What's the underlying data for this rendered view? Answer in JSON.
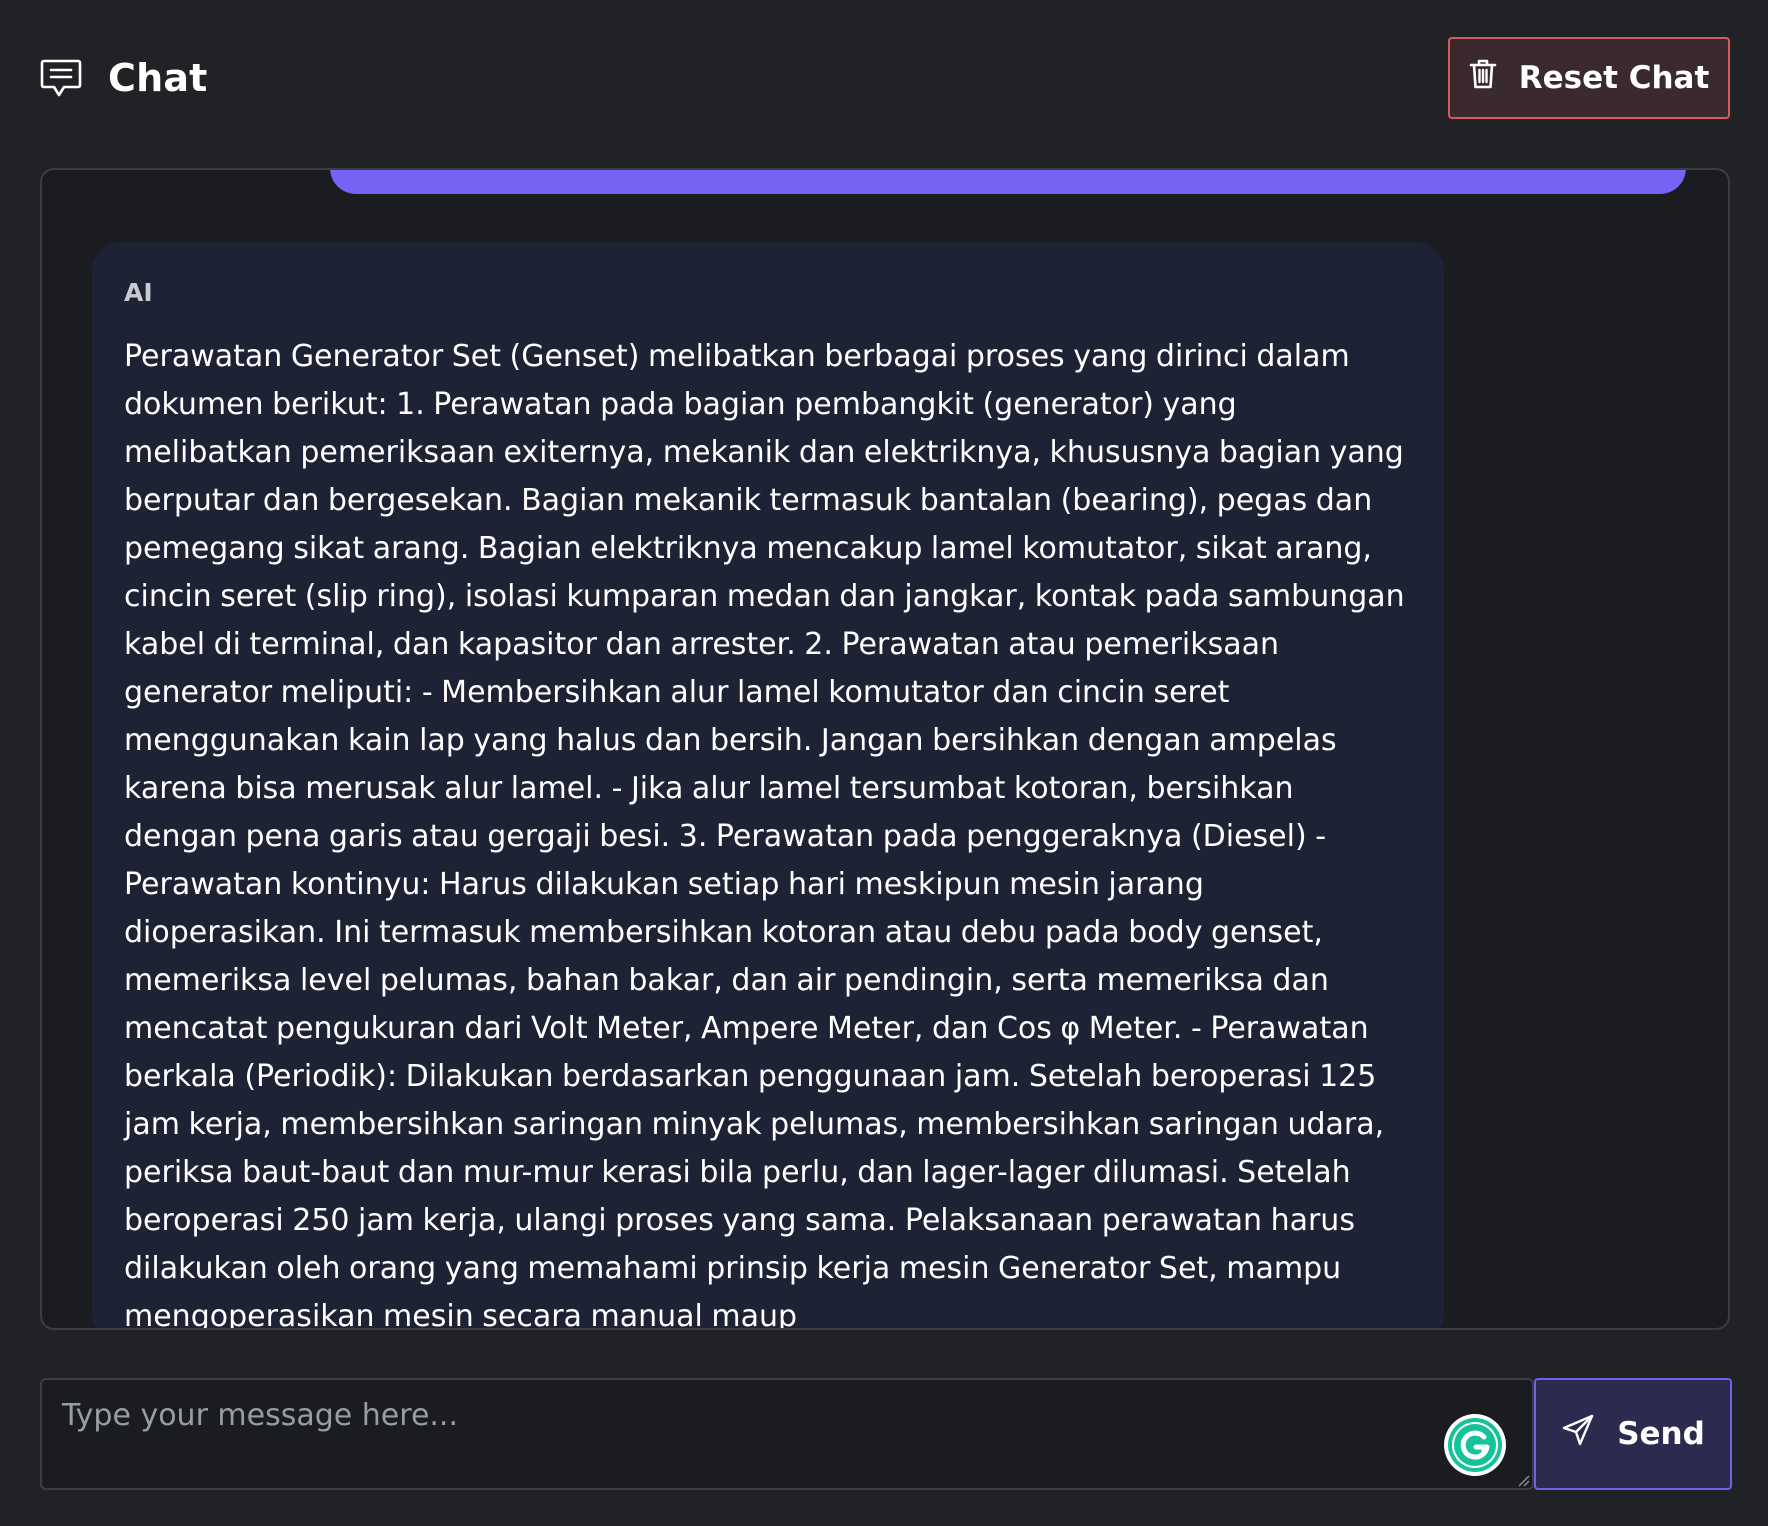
{
  "header": {
    "title": "Chat",
    "title_icon": "chat-bubble-icon",
    "reset_label": "Reset Chat",
    "reset_icon": "trash-icon"
  },
  "messages": {
    "ai": {
      "sender": "AI",
      "text": "Perawatan Generator Set (Genset) melibatkan berbagai proses yang dirinci dalam dokumen berikut: 1. Perawatan pada bagian pembangkit (generator) yang melibatkan pemeriksaan exiternya, mekanik dan elektriknya, khususnya bagian yang berputar dan bergesekan. Bagian mekanik termasuk bantalan (bearing), pegas dan pemegang sikat arang. Bagian elektriknya mencakup lamel komutator, sikat arang, cincin seret (slip ring), isolasi kumparan medan dan jangkar, kontak pada sambungan kabel di terminal, dan kapasitor dan arrester. 2. Perawatan atau pemeriksaan generator meliputi: - Membersihkan alur lamel komutator dan cincin seret menggunakan kain lap yang halus dan bersih. Jangan bersihkan dengan ampelas karena bisa merusak alur lamel. - Jika alur lamel tersumbat kotoran, bersihkan dengan pena garis atau gergaji besi. 3. Perawatan pada penggeraknya (Diesel) - Perawatan kontinyu: Harus dilakukan setiap hari meskipun mesin jarang dioperasikan. Ini termasuk membersihkan kotoran atau debu pada body genset, memeriksa level pelumas, bahan bakar, dan air pendingin, serta memeriksa dan mencatat pengukuran dari Volt Meter, Ampere Meter, dan Cos φ Meter. - Perawatan berkala (Periodik): Dilakukan berdasarkan penggunaan jam. Setelah beroperasi 125 jam kerja, membersihkan saringan minyak pelumas, membersihkan saringan udara, periksa baut-baut dan mur-mur kerasi bila perlu, dan lager-lager dilumasi. Setelah beroperasi 250 jam kerja, ulangi proses yang sama. Pelaksanaan perawatan harus dilakukan oleh orang yang memahami prinsip kerja mesin Generator Set, mampu mengoperasikan mesin secara manual maup"
    }
  },
  "composer": {
    "placeholder": "Type your message here...",
    "value": "",
    "send_label": "Send",
    "send_icon": "paper-plane-icon",
    "extension_icon": "grammarly-icon"
  },
  "colors": {
    "background": "#202226",
    "panel": "#1b1c20",
    "ai_bubble": "#1d2235",
    "user_bubble": "#7763f3",
    "reset_border": "#d75a5a",
    "send_border": "#6e63e6"
  }
}
